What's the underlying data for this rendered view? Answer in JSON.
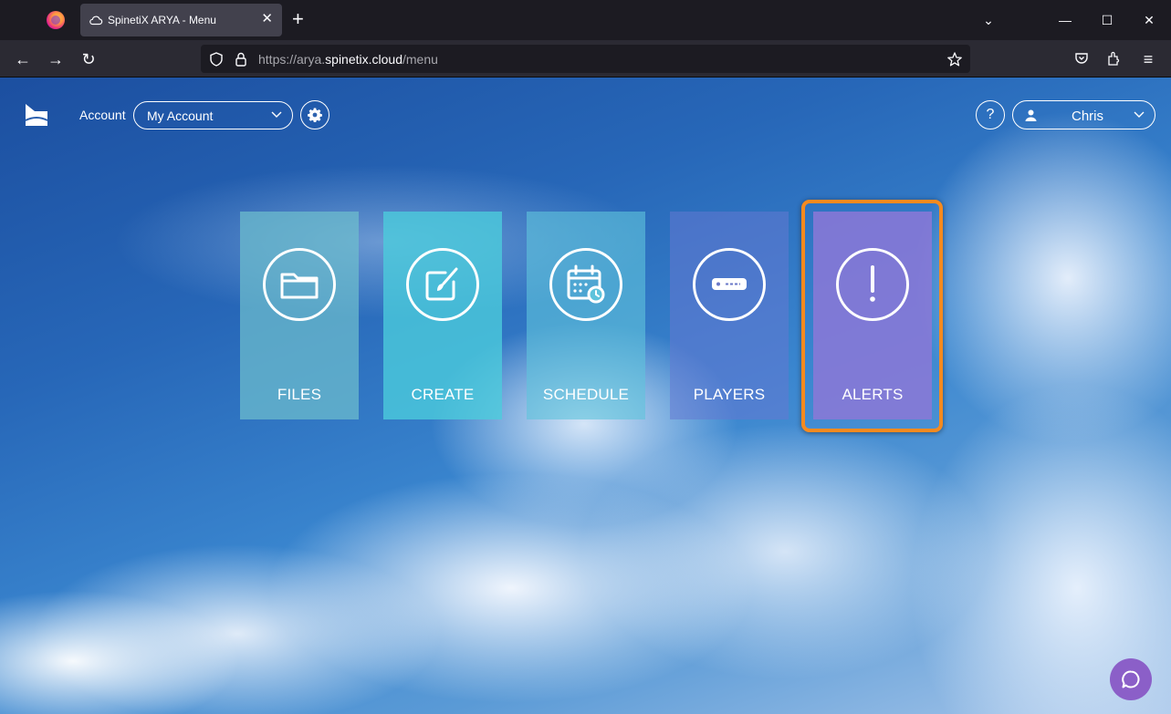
{
  "browser": {
    "tab_title": "SpinetiX ARYA - Menu",
    "tab_close": "✕",
    "new_tab": "+",
    "url_prefix": "https://arya.",
    "url_domain": "spinetix.cloud",
    "url_path": "/menu",
    "window_controls": {
      "list": "⌄",
      "minimize": "—",
      "maximize": "☐",
      "close": "✕"
    },
    "nav": {
      "back": "←",
      "forward": "→",
      "reload": "↻",
      "menu": "≡"
    }
  },
  "header": {
    "account_label": "Account",
    "account_value": "My Account",
    "help_label": "?",
    "user_name": "Chris"
  },
  "tiles": [
    {
      "label": "FILES",
      "icon": "folder-icon"
    },
    {
      "label": "CREATE",
      "icon": "edit-brush-icon"
    },
    {
      "label": "SCHEDULE",
      "icon": "calendar-clock-icon"
    },
    {
      "label": "PLAYERS",
      "icon": "player-device-icon"
    },
    {
      "label": "ALERTS",
      "icon": "exclamation-icon"
    }
  ],
  "colors": {
    "highlight": "#f58a1f",
    "chat_button": "#8b5fc8",
    "tab_bg": "#42414d",
    "toolbar_bg": "#2b2a33"
  }
}
